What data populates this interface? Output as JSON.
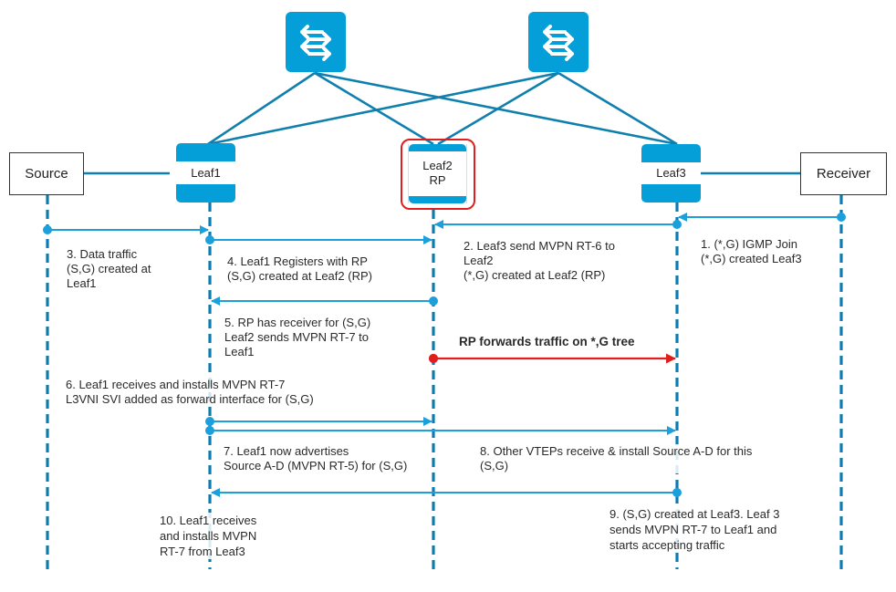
{
  "diagram": {
    "title": "",
    "colors": {
      "device_blue": "#049fd9",
      "link_teal": "#0f7fad",
      "lifeline": "#0e7bb0",
      "message_arrow": "#1ba0dc",
      "highlight_red": "#e01e1e",
      "text": "#2a2a2a"
    },
    "spines": [
      {
        "id": "spine1",
        "icon": "switch-arrows-icon"
      },
      {
        "id": "spine2",
        "icon": "switch-arrows-icon"
      }
    ],
    "leaves": [
      {
        "id": "leaf1",
        "label": "Leaf1"
      },
      {
        "id": "leaf2",
        "label": "Leaf2\nRP",
        "highlighted": true
      },
      {
        "id": "leaf3",
        "label": "Leaf3"
      }
    ],
    "endpoints": {
      "source": "Source",
      "receiver": "Receiver"
    },
    "messages": [
      {
        "from": "receiver",
        "to": "leaf3",
        "step": 1
      },
      {
        "from": "leaf3",
        "to": "leaf2",
        "step": 2
      },
      {
        "from": "source",
        "to": "leaf1",
        "step": 3
      },
      {
        "from": "leaf1",
        "to": "leaf2",
        "step": 4
      },
      {
        "from": "leaf2",
        "to": "leaf1",
        "step": 5
      },
      {
        "from": "leaf2",
        "to": "leaf3",
        "step": "rp-forward",
        "highlight": true
      },
      {
        "from": "leaf1",
        "to": "leaf2",
        "step": 7
      },
      {
        "from": "leaf1",
        "to": "leaf3",
        "step": 8
      },
      {
        "from": "leaf3",
        "to": "leaf1",
        "step": 9
      }
    ],
    "notes": {
      "n1": "1. (*,G) IGMP Join\n(*,G) created Leaf3",
      "n2": "2. Leaf3 send MVPN RT-6 to\nLeaf2\n(*,G) created at Leaf2 (RP)",
      "n3": "3. Data traffic\n(S,G) created at\nLeaf1",
      "n4": "4. Leaf1 Registers with RP\n(S,G) created at Leaf2 (RP)",
      "n5": "5. RP has receiver for (S,G)\nLeaf2 sends MVPN RT-7 to\nLeaf1",
      "rp": "RP forwards traffic on *,G tree",
      "n6": "6. Leaf1 receives and installs MVPN RT-7\nL3VNI SVI added as forward interface for (S,G)",
      "n7": "7. Leaf1 now advertises\nSource A-D (MVPN RT-5) for (S,G)",
      "n8": "8. Other VTEPs receive & install Source A-D for this\n(S,G)",
      "n9": "9. (S,G) created at Leaf3. Leaf 3\nsends MVPN RT-7 to Leaf1 and\nstarts accepting traffic",
      "n10": "10. Leaf1 receives\nand installs MVPN\nRT-7 from Leaf3"
    }
  }
}
